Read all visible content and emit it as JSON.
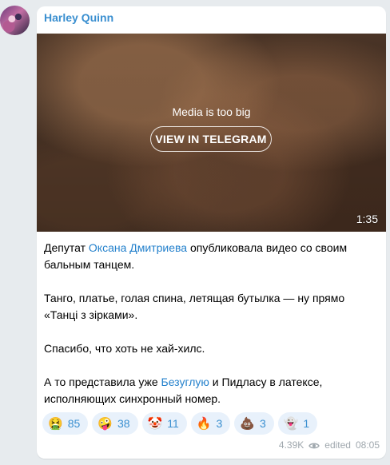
{
  "author": {
    "name": "Harley Quinn"
  },
  "media": {
    "note": "Media is too big",
    "button_label": "VIEW IN TELEGRAM",
    "duration": "1:35"
  },
  "post": {
    "p1_a": "Депутат ",
    "p1_link": "Оксана Дмитриева",
    "p1_b": " опубликовала видео со своим бальным танцем.",
    "p2": "Танго, платье, голая спина, летящая бутылка — ну прямо «Танці з зірками».",
    "p3": "Спасибо, что хоть не хай-хилс.",
    "p4_a": "А то представила уже ",
    "p4_link": "Безуглую",
    "p4_b": " и Пидласу в латексе, исполняющих синхронный номер."
  },
  "reactions": [
    {
      "emoji": "🤮",
      "count": "85"
    },
    {
      "emoji": "🤪",
      "count": "38"
    },
    {
      "emoji": "🤡",
      "count": "11"
    },
    {
      "emoji": "🔥",
      "count": "3"
    },
    {
      "emoji": "💩",
      "count": "3"
    },
    {
      "emoji": "👻",
      "count": "1"
    }
  ],
  "footer": {
    "views": "4.39K",
    "views_icon": "eye-icon",
    "edited": "edited",
    "time": "08:05"
  },
  "colors": {
    "accent": "#3a8fd0",
    "link": "#2481cc",
    "background": "#e7ebee",
    "bubble": "#ffffff"
  }
}
